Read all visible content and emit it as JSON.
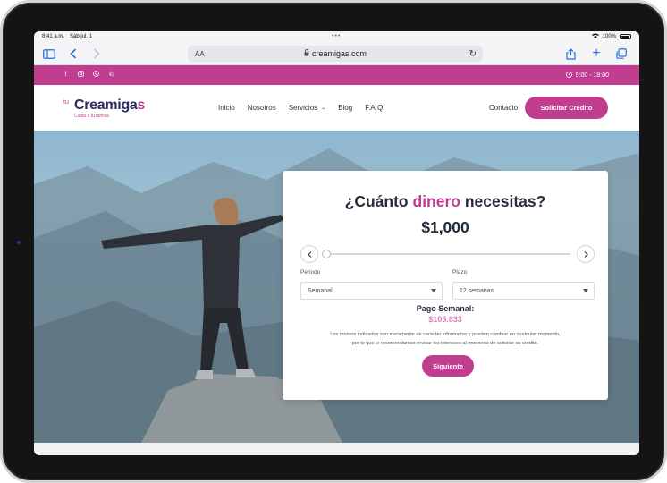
{
  "status_bar": {
    "time": "8:41 a.m.",
    "date": "Sáb jul. 1",
    "battery": "100%"
  },
  "browser": {
    "text_size_label": "AA",
    "url": "creamigas.com",
    "icons": [
      "sidebar-icon",
      "back-icon",
      "forward-icon",
      "lock-icon",
      "reload-icon",
      "share-icon",
      "new-tab-icon",
      "tabs-icon"
    ]
  },
  "topbar": {
    "social_icons": [
      "facebook-icon",
      "instagram-icon",
      "whatsapp-icon",
      "phone-icon"
    ],
    "hours": "9:00 - 18:00"
  },
  "logo": {
    "prefix": "tu",
    "name": "Creamiga",
    "name_end": "s",
    "tagline": "Cuida a tu familia"
  },
  "nav": {
    "items": [
      {
        "label": "Inicio"
      },
      {
        "label": "Nosotros"
      },
      {
        "label": "Servicios"
      },
      {
        "label": "Blog"
      },
      {
        "label": "F.A.Q."
      }
    ],
    "contact": "Contacto",
    "cta": "Solicitar Crédito"
  },
  "calculator": {
    "title_before": "¿Cuánto",
    "title_highlight": "dinero",
    "title_after": "necesitas?",
    "amount": "$1,000",
    "slider_fraction": 0.0,
    "periodo_label": "Periodo",
    "periodo_value": "Semanal",
    "plazo_label": "Plazo",
    "plazo_value": "12 semanas",
    "payment_label": "Pago Semanal:",
    "payment_value": "$105.833",
    "disclaimer_1": "Los montos indicados son meramente de carácter informativo y pueden cambiar en cualquier momento,",
    "disclaimer_2": "por lo que le recomendamos revisar los intereses al momento de solicitar su crédito.",
    "next_button": "Siguiente"
  },
  "colors": {
    "brand_pink": "#c13d8f",
    "brand_navy": "#2c2a63",
    "browser_blue": "#1f6fe5"
  }
}
